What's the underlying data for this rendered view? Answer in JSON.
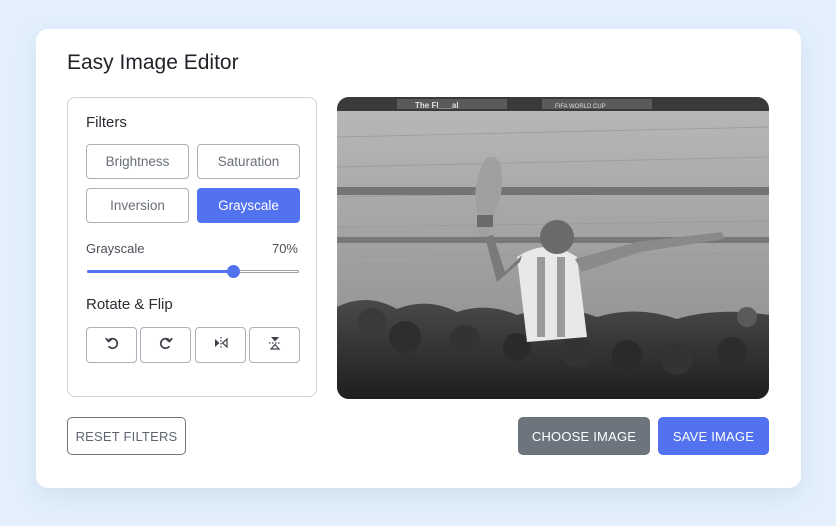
{
  "app": {
    "title": "Easy Image Editor"
  },
  "filters": {
    "section_title": "Filters",
    "buttons": [
      {
        "label": "Brightness",
        "active": false
      },
      {
        "label": "Saturation",
        "active": false
      },
      {
        "label": "Inversion",
        "active": false
      },
      {
        "label": "Grayscale",
        "active": true
      }
    ],
    "slider": {
      "label": "Grayscale",
      "value_text": "70%",
      "value": 70
    }
  },
  "rotate_flip": {
    "section_title": "Rotate & Flip",
    "icons": [
      "rotate-left-icon",
      "rotate-right-icon",
      "flip-horizontal-icon",
      "flip-vertical-icon"
    ]
  },
  "preview": {
    "banner_left": "The FI___al",
    "banner_right": "FIFA WORLD CUP"
  },
  "actions": {
    "reset_label": "RESET FILTERS",
    "choose_label": "CHOOSE IMAGE",
    "save_label": "SAVE IMAGE"
  },
  "colors": {
    "accent": "#5372f0",
    "secondary": "#6c757d",
    "background": "#e3f0fc"
  }
}
